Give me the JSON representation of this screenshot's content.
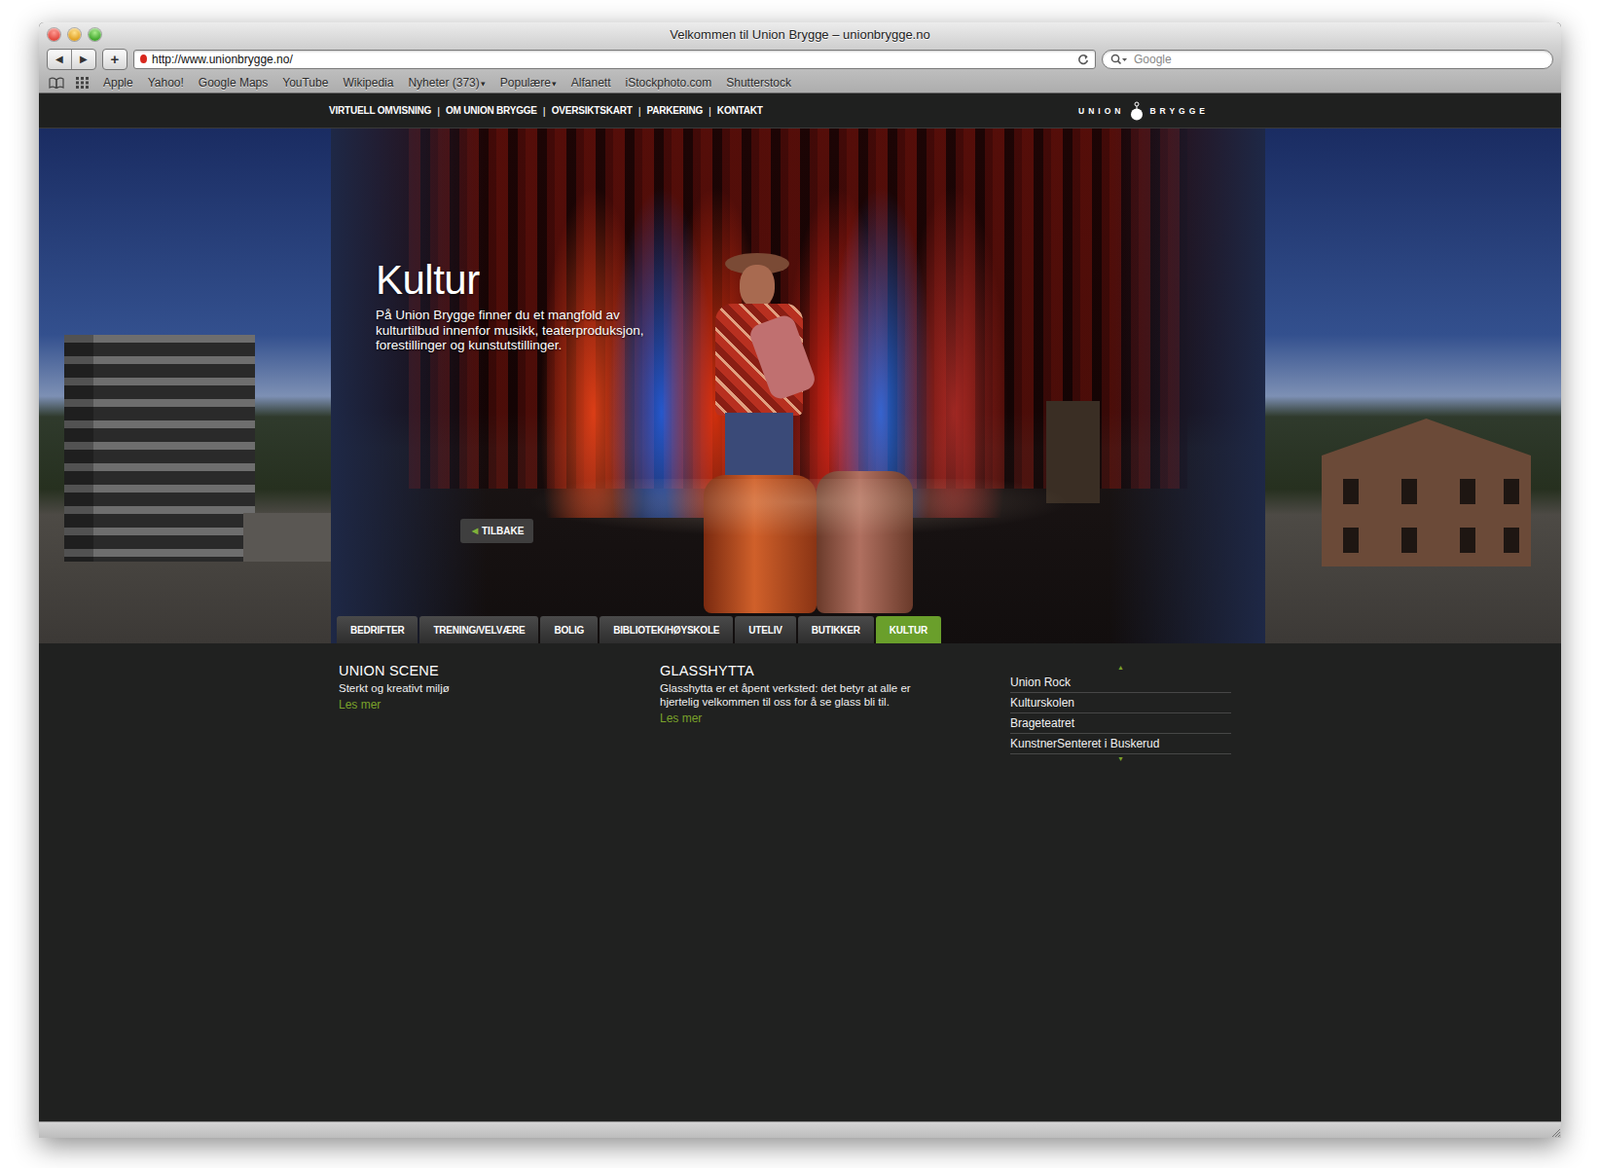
{
  "window": {
    "title": "Velkommen til Union Brygge – unionbrygge.no"
  },
  "toolbar": {
    "back": "◀",
    "forward": "▶",
    "add": "+",
    "url": "http://www.unionbrygge.no/",
    "search": {
      "placeholder": "Google"
    }
  },
  "bookmarks": [
    {
      "label": "Apple"
    },
    {
      "label": "Yahoo!"
    },
    {
      "label": "Google Maps"
    },
    {
      "label": "YouTube"
    },
    {
      "label": "Wikipedia"
    },
    {
      "label": "Nyheter (373)",
      "arrow": "▾"
    },
    {
      "label": "Populære",
      "arrow": "▾"
    },
    {
      "label": "Alfanett"
    },
    {
      "label": "iStockphoto.com"
    },
    {
      "label": "Shutterstock"
    }
  ],
  "site": {
    "nav": {
      "links": [
        "VIRTUELL OMVISNING",
        "OM UNION BRYGGE",
        "OVERSIKTSKART",
        "PARKERING",
        "KONTAKT"
      ],
      "separator": "|"
    },
    "logo": {
      "left": "UNION",
      "right": "BRYGGE"
    }
  },
  "hero": {
    "title": "Kultur",
    "text": "På Union Brygge finner du et mangfold av kulturtilbud innenfor musikk, teaterproduksjon, forestillinger og kunstutstillinger.",
    "back": {
      "arrow": "◀",
      "label": "TILBAKE"
    }
  },
  "tabs": [
    {
      "label": "BEDRIFTER",
      "selected": false
    },
    {
      "label": "TRENING/VELVÆRE",
      "selected": false
    },
    {
      "label": "BOLIG",
      "selected": false
    },
    {
      "label": "BIBLIOTEK/HØYSKOLE",
      "selected": false
    },
    {
      "label": "UTELIV",
      "selected": false
    },
    {
      "label": "BUTIKKER",
      "selected": false
    },
    {
      "label": "KULTUR",
      "selected": true
    }
  ],
  "features": [
    {
      "title": "UNION SCENE",
      "text": "Sterkt og kreativt miljø",
      "link": "Les mer"
    },
    {
      "title": "GLASSHYTTA",
      "text": "Glasshytta er et åpent verksted: det betyr at alle er hjertelig velkommen til oss for å se glass bli til.",
      "link": "Les mer"
    }
  ],
  "list": {
    "up": "▲",
    "down": "▼",
    "items": [
      "Union Rock",
      "Kulturskolen",
      "Brageteatret",
      "KunstnerSenteret i Buskerud"
    ]
  }
}
